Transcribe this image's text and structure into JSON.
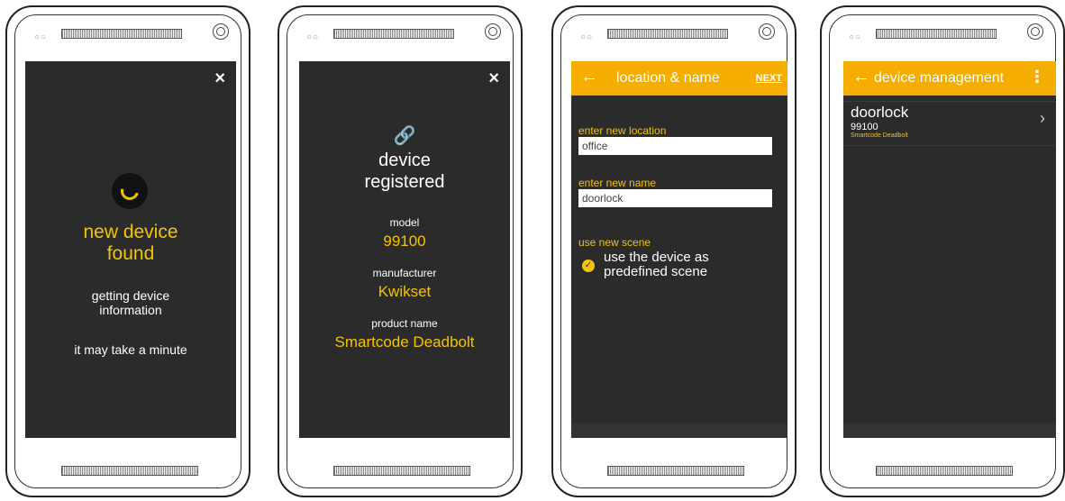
{
  "screen1": {
    "close_icon": "×",
    "title_line1": "new device",
    "title_line2": "found",
    "info_line1": "getting device",
    "info_line2": "information",
    "note": "it may take a minute"
  },
  "screen2": {
    "close_icon": "×",
    "link_icon": "🔗",
    "title_line1": "device",
    "title_line2": "registered",
    "model_label": "model",
    "model_value": "99100",
    "manufacturer_label": "manufacturer",
    "manufacturer_value": "Kwikset",
    "product_label": "product name",
    "product_value": "Smartcode Deadbolt"
  },
  "screen3": {
    "back_icon": "←",
    "title": "location & name",
    "next_label": "NEXT",
    "location_label": "enter new location",
    "location_value": "office",
    "name_label": "enter new name",
    "name_value": "doorlock",
    "scene_label": "use new scene",
    "scene_option_line1": "use the device as",
    "scene_option_line2": "predefined scene"
  },
  "screen4": {
    "back_icon": "←",
    "title": "device management",
    "more_icon": "⋮",
    "item_name": "doorlock",
    "item_model": "99100",
    "item_product": "Smartcode Deadbolt",
    "chevron_icon": "›"
  },
  "colors": {
    "accent": "#f5c400",
    "appbar": "#f5ad00",
    "screen_bg": "#2b2b2b"
  }
}
